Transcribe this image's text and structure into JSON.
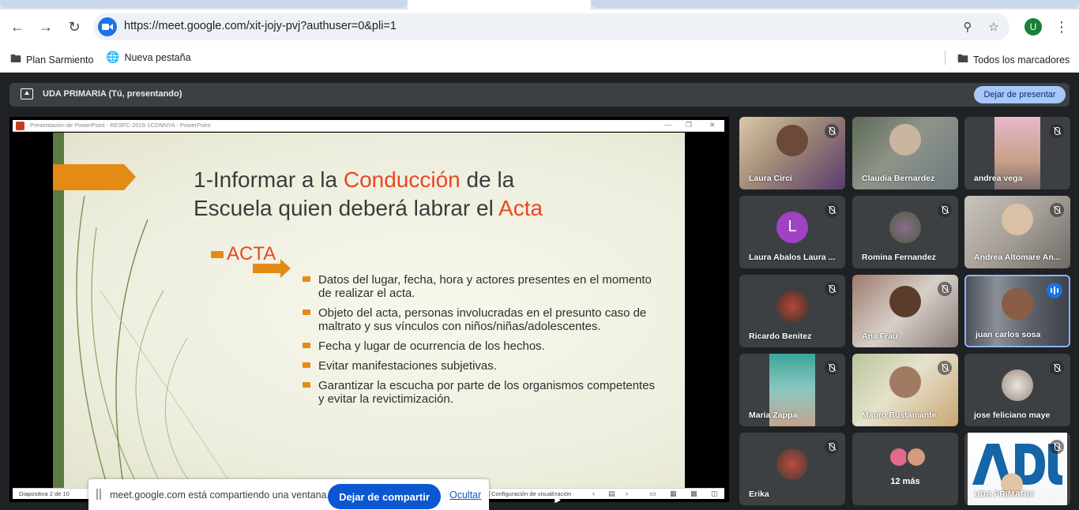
{
  "browser": {
    "url": "https://meet.google.com/xit-jojy-pvj?authuser=0&pli=1",
    "profile_initial": "U",
    "bookmarks": [
      {
        "label": "Plan Sarmiento",
        "icon": "folder-icon"
      },
      {
        "label": "Nueva pestaña",
        "icon": "globe-icon"
      }
    ],
    "all_bookmarks": "Todos los marcadores"
  },
  "meet": {
    "presenting_title": "UDA PRIMARIA (Tú, presentando)",
    "stop_presenting": "Dejar de presentar",
    "share_message": "meet.google.com está compartiendo una ventana.",
    "stop_sharing": "Dejar de compartir",
    "hide": "Ocultar"
  },
  "ppt": {
    "window_title": "Presentación de PowerPoint  -  RESFC-2016-1CDNNYA - PowerPoint",
    "slide_number": "Diapositiva 2 de 10",
    "view_settings": "Configuración de visualización"
  },
  "slide": {
    "title_part1": "1-Informar a la ",
    "title_highlight1": "Conducción",
    "title_part2": " de la",
    "title_line2": "Escuela quien deberá labrar el ",
    "title_highlight2": "Acta",
    "section": "ACTA",
    "bullets": [
      "Datos del lugar, fecha, hora y actores presentes en el momento de realizar el acta.",
      "Objeto del acta, personas involucradas en el presunto caso de maltrato y sus vínculos con niños/niñas/adolescentes.",
      "Fecha y lugar de ocurrencia de los hechos.",
      "Evitar manifestaciones subjetivas.",
      "Garantizar la escucha por parte de los organismos competentes y evitar la revictimización."
    ],
    "colors": {
      "accent_red": "#e64823",
      "arrow_orange": "#e48b16"
    }
  },
  "participants": [
    {
      "name": "Laura Circi",
      "muted": true
    },
    {
      "name": "Claudia Bernardez",
      "muted": false
    },
    {
      "name": "andrea vega",
      "muted": true
    },
    {
      "name": "Laura Abalos Laura ...",
      "muted": true,
      "avatar_letter": "L",
      "avatar_color": "#a142c5"
    },
    {
      "name": "Romina Fernandez",
      "muted": true
    },
    {
      "name": "Andrea Altomare An...",
      "muted": true
    },
    {
      "name": "Ricardo Benitez",
      "muted": true
    },
    {
      "name": "Ana Frau",
      "muted": true
    },
    {
      "name": "juan carlos sosa",
      "muted": false,
      "speaking": true
    },
    {
      "name": "Maria Zappa",
      "muted": true
    },
    {
      "name": "Mauro Bustamante",
      "muted": true
    },
    {
      "name": "jose feliciano maye",
      "muted": true
    },
    {
      "name": "Erika",
      "muted": true
    },
    {
      "name": "12 más",
      "muted": false
    },
    {
      "name": "UDA PRIMARIA",
      "muted": true
    }
  ]
}
